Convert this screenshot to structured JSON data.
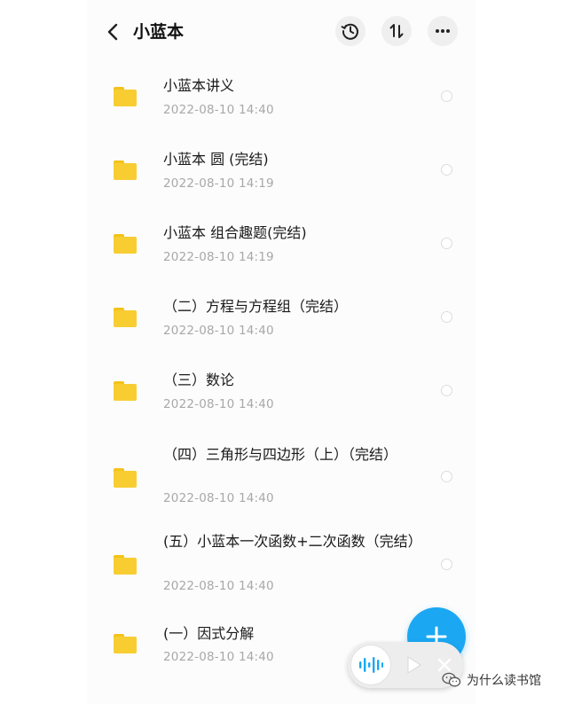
{
  "header": {
    "title": "小蓝本",
    "back_icon": "chevron-left-icon",
    "history_icon": "history-icon",
    "sort_icon": "sort-icon",
    "more_icon": "more-icon"
  },
  "files": [
    {
      "name": "小蓝本讲义",
      "date": "2022-08-10  14:40"
    },
    {
      "name": "小蓝本 圆 (完结)",
      "date": "2022-08-10  14:19"
    },
    {
      "name": "小蓝本 组合趣题(完结)",
      "date": "2022-08-10  14:19"
    },
    {
      "name": "（二）方程与方程组（完结）",
      "date": "2022-08-10  14:40"
    },
    {
      "name": "（三）数论",
      "date": "2022-08-10  14:40"
    },
    {
      "name": "（四）三角形与四边形（上）（完结）",
      "date": "2022-08-10  14:40"
    },
    {
      "name": "(五）小蓝本一次函数+二次函数（完结）",
      "date": "2022-08-10  14:40"
    },
    {
      "name": "(一）因式分解",
      "date": "2022-08-10  14:40"
    }
  ],
  "fab": {
    "icon": "plus-icon"
  },
  "player": {
    "icons": [
      "audio-wave-icon",
      "play-icon",
      "close-icon"
    ]
  },
  "watermark": {
    "text": "为什么读书馆",
    "icon": "wechat-icon"
  },
  "colors": {
    "folder": "#f7cd32",
    "accent": "#1ba7f2",
    "date": "#a8a8a8"
  }
}
